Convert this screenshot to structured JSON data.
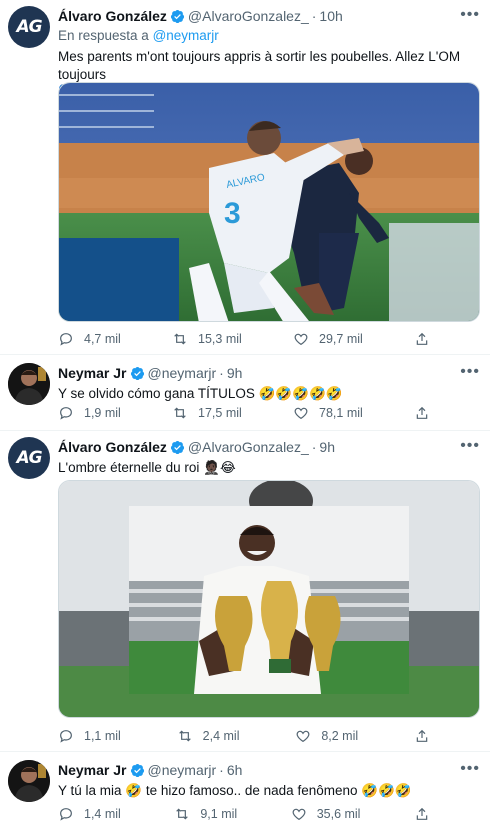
{
  "tweets": [
    {
      "name": "Álvaro González",
      "handle": "@AlvaroGonzalez_",
      "time": "10h",
      "reply_prefix": "En respuesta a",
      "reply_mention": "@neymarjr",
      "text": "Mes parents m'ont toujours appris à sortir les poubelles. Allez L'OM toujours",
      "emoji": "💙",
      "stats": {
        "replies": "4,7 mil",
        "retweets": "15,3 mil",
        "likes": "29,7 mil"
      }
    },
    {
      "name": "Neymar Jr",
      "handle": "@neymarjr",
      "time": "9h",
      "text": "Y se olvido cómo gana TÍTULOS 🤣🤣🤣🤣🤣",
      "stats": {
        "replies": "1,9 mil",
        "retweets": "17,5 mil",
        "likes": "78,1 mil"
      }
    },
    {
      "name": "Álvaro González",
      "handle": "@AlvaroGonzalez_",
      "time": "9h",
      "text": "L'ombre éternelle du roi 🤵🏿😂",
      "stats": {
        "replies": "1,1 mil",
        "retweets": "2,4 mil",
        "likes": "8,2 mil"
      }
    },
    {
      "name": "Neymar Jr",
      "handle": "@neymarjr",
      "time": "6h",
      "text": "Y tú la mia 🤣 te hizo famoso.. de nada fenômeno 🤣🤣🤣",
      "stats": {
        "replies": "1,4 mil",
        "retweets": "9,1 mil",
        "likes": "35,6 mil"
      }
    }
  ],
  "avatar_ag_text": "AG",
  "jersey_text": "3",
  "jersey_name": "ALVARO",
  "more_glyph": "•••",
  "dot_glyph": "·",
  "colors": {
    "accent": "#1d9bf0",
    "muted": "#536471",
    "verified": "#1d9bf0"
  }
}
